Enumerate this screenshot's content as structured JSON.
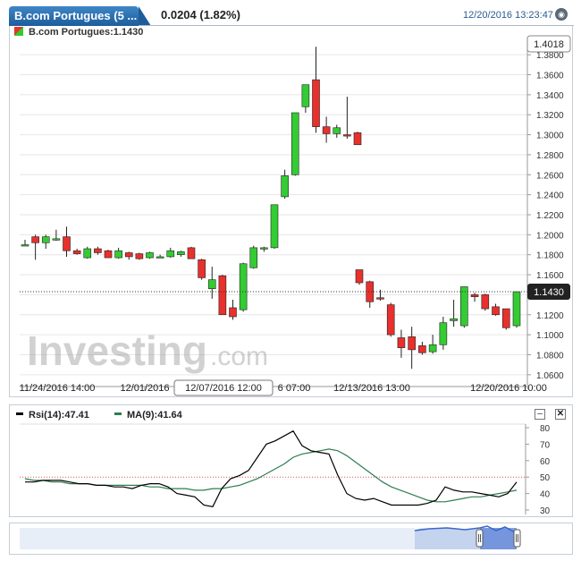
{
  "header": {
    "tab_title": "B.com Portugues (5 ...",
    "price_change": "0.0204 (1.82%)",
    "timestamp": "12/20/2016 13:23:47"
  },
  "legend": {
    "label": "B.com Portugues:1.1430"
  },
  "watermark": {
    "brand": "Investing",
    "suffix": ".com"
  },
  "price_tags": {
    "high": "1.4018",
    "last": "1.1430"
  },
  "rsi_legend": {
    "rsi_label": "Rsi(14):47.41",
    "ma_label": "MA(9):41.64",
    "rsi_color": "#000000",
    "ma_color": "#2e7d4f"
  },
  "colors": {
    "up": "#33cc33",
    "down": "#e8302c",
    "grid": "#e6e6e6",
    "rsi": "#000000",
    "ma": "#2e7d4f",
    "ref": "#e05050",
    "navigator_fill": "#c4d3ee",
    "navigator_line": "#3a66cc"
  },
  "chart_data": [
    {
      "type": "candlestick",
      "title": "",
      "ylim": [
        1.05,
        1.39
      ],
      "yticks": [
        "1.3800",
        "1.3600",
        "1.3400",
        "1.3200",
        "1.3000",
        "1.2800",
        "1.2600",
        "1.2400",
        "1.2200",
        "1.2000",
        "1.1800",
        "1.1600",
        "1.1400",
        "1.1200",
        "1.1000",
        "1.0800",
        "1.0600"
      ],
      "xtick_labels": [
        "11/24/2016 14:00",
        "12/01/2016",
        "12/07/2016 12:00",
        "6 07:00",
        "12/13/2016 13:00",
        "12/20/2016 10:00"
      ],
      "last_price": 1.143,
      "high_marker": 1.4018,
      "candles": [
        {
          "o": 1.19,
          "h": 1.195,
          "l": 1.19,
          "c": 1.19
        },
        {
          "o": 1.198,
          "h": 1.2,
          "l": 1.175,
          "c": 1.192
        },
        {
          "o": 1.192,
          "h": 1.2,
          "l": 1.186,
          "c": 1.198
        },
        {
          "o": 1.196,
          "h": 1.205,
          "l": 1.194,
          "c": 1.196
        },
        {
          "o": 1.198,
          "h": 1.208,
          "l": 1.178,
          "c": 1.184
        },
        {
          "o": 1.184,
          "h": 1.186,
          "l": 1.18,
          "c": 1.181
        },
        {
          "o": 1.177,
          "h": 1.188,
          "l": 1.176,
          "c": 1.186
        },
        {
          "o": 1.186,
          "h": 1.188,
          "l": 1.18,
          "c": 1.182
        },
        {
          "o": 1.184,
          "h": 1.185,
          "l": 1.177,
          "c": 1.177
        },
        {
          "o": 1.177,
          "h": 1.187,
          "l": 1.176,
          "c": 1.184
        },
        {
          "o": 1.182,
          "h": 1.183,
          "l": 1.175,
          "c": 1.178
        },
        {
          "o": 1.181,
          "h": 1.182,
          "l": 1.175,
          "c": 1.176
        },
        {
          "o": 1.177,
          "h": 1.183,
          "l": 1.176,
          "c": 1.182
        },
        {
          "o": 1.178,
          "h": 1.18,
          "l": 1.177,
          "c": 1.178
        },
        {
          "o": 1.178,
          "h": 1.187,
          "l": 1.177,
          "c": 1.184
        },
        {
          "o": 1.18,
          "h": 1.184,
          "l": 1.178,
          "c": 1.183
        },
        {
          "o": 1.187,
          "h": 1.188,
          "l": 1.176,
          "c": 1.176
        },
        {
          "o": 1.175,
          "h": 1.176,
          "l": 1.155,
          "c": 1.157
        },
        {
          "o": 1.146,
          "h": 1.168,
          "l": 1.136,
          "c": 1.155
        },
        {
          "o": 1.159,
          "h": 1.16,
          "l": 1.12,
          "c": 1.12
        },
        {
          "o": 1.127,
          "h": 1.135,
          "l": 1.115,
          "c": 1.118
        },
        {
          "o": 1.125,
          "h": 1.172,
          "l": 1.123,
          "c": 1.171
        },
        {
          "o": 1.167,
          "h": 1.189,
          "l": 1.166,
          "c": 1.187
        },
        {
          "o": 1.186,
          "h": 1.188,
          "l": 1.183,
          "c": 1.187
        },
        {
          "o": 1.187,
          "h": 1.23,
          "l": 1.186,
          "c": 1.23
        },
        {
          "o": 1.238,
          "h": 1.265,
          "l": 1.236,
          "c": 1.259
        },
        {
          "o": 1.26,
          "h": 1.322,
          "l": 1.259,
          "c": 1.322
        },
        {
          "o": 1.328,
          "h": 1.35,
          "l": 1.322,
          "c": 1.35
        },
        {
          "o": 1.355,
          "h": 1.388,
          "l": 1.302,
          "c": 1.308
        },
        {
          "o": 1.308,
          "h": 1.318,
          "l": 1.292,
          "c": 1.301
        },
        {
          "o": 1.301,
          "h": 1.31,
          "l": 1.297,
          "c": 1.307
        },
        {
          "o": 1.3,
          "h": 1.338,
          "l": 1.296,
          "c": 1.299
        },
        {
          "o": 1.302,
          "h": 1.303,
          "l": 1.29,
          "c": 1.29
        },
        {
          "o": 1.165,
          "h": 1.165,
          "l": 1.15,
          "c": 1.152
        },
        {
          "o": 1.153,
          "h": 1.154,
          "l": 1.127,
          "c": 1.133
        },
        {
          "o": 1.137,
          "h": 1.145,
          "l": 1.134,
          "c": 1.136
        },
        {
          "o": 1.13,
          "h": 1.132,
          "l": 1.098,
          "c": 1.1
        },
        {
          "o": 1.097,
          "h": 1.105,
          "l": 1.077,
          "c": 1.087
        },
        {
          "o": 1.098,
          "h": 1.108,
          "l": 1.066,
          "c": 1.085
        },
        {
          "o": 1.089,
          "h": 1.093,
          "l": 1.08,
          "c": 1.082
        },
        {
          "o": 1.083,
          "h": 1.1,
          "l": 1.081,
          "c": 1.09
        },
        {
          "o": 1.09,
          "h": 1.118,
          "l": 1.085,
          "c": 1.112
        },
        {
          "o": 1.114,
          "h": 1.135,
          "l": 1.108,
          "c": 1.116
        },
        {
          "o": 1.109,
          "h": 1.148,
          "l": 1.107,
          "c": 1.148
        },
        {
          "o": 1.14,
          "h": 1.142,
          "l": 1.133,
          "c": 1.138
        },
        {
          "o": 1.14,
          "h": 1.141,
          "l": 1.124,
          "c": 1.126
        },
        {
          "o": 1.128,
          "h": 1.131,
          "l": 1.119,
          "c": 1.12
        },
        {
          "o": 1.126,
          "h": 1.126,
          "l": 1.105,
          "c": 1.107
        },
        {
          "o": 1.109,
          "h": 1.143,
          "l": 1.107,
          "c": 1.143
        }
      ]
    },
    {
      "type": "line",
      "title": "",
      "ylim": [
        30,
        80
      ],
      "yticks": [
        80,
        70,
        60,
        50,
        40,
        30
      ],
      "reference_line": 50,
      "series": [
        {
          "name": "Rsi(14):47.41",
          "values": [
            47,
            47,
            48,
            48,
            48,
            47,
            46,
            46,
            45,
            45,
            44,
            44,
            43,
            45,
            46,
            46,
            44,
            40,
            39,
            38,
            33,
            32,
            43,
            49,
            51,
            54,
            62,
            70,
            72,
            75,
            78,
            69,
            66,
            65,
            64,
            51,
            40,
            37,
            36,
            37,
            35,
            33,
            33,
            33,
            33,
            34,
            36,
            44,
            42,
            41,
            41,
            40,
            39,
            38,
            40,
            47
          ]
        },
        {
          "name": "MA(9):41.64",
          "values": [
            49,
            48,
            48,
            47,
            47,
            46,
            46,
            46,
            45,
            45,
            45,
            45,
            45,
            45,
            44,
            44,
            43,
            43,
            43,
            42,
            42,
            43,
            43,
            44,
            45,
            47,
            49,
            52,
            55,
            58,
            62,
            64,
            65,
            66,
            67,
            66,
            63,
            59,
            55,
            51,
            47,
            44,
            42,
            40,
            38,
            36,
            35,
            35,
            36,
            37,
            38,
            38,
            39,
            40,
            41,
            42
          ]
        }
      ]
    }
  ]
}
